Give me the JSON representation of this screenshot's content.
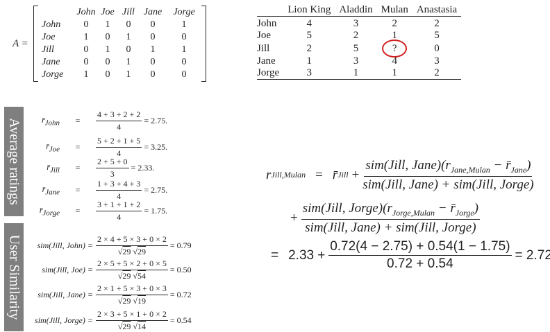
{
  "matrix": {
    "label": "A =",
    "col_headers": [
      "John",
      "Joe",
      "Jill",
      "Jane",
      "Jorge"
    ],
    "rows": [
      {
        "name": "John",
        "values": [
          "0",
          "1",
          "0",
          "0",
          "1"
        ]
      },
      {
        "name": "Joe",
        "values": [
          "1",
          "0",
          "1",
          "0",
          "0"
        ]
      },
      {
        "name": "Jill",
        "values": [
          "0",
          "1",
          "0",
          "1",
          "1"
        ]
      },
      {
        "name": "Jane",
        "values": [
          "0",
          "0",
          "1",
          "0",
          "0"
        ]
      },
      {
        "name": "Jorge",
        "values": [
          "1",
          "0",
          "1",
          "0",
          "0"
        ]
      }
    ]
  },
  "ratings": {
    "headers": [
      "Lion King",
      "Aladdin",
      "Mulan",
      "Anastasia"
    ],
    "rows": [
      {
        "name": "John",
        "values": [
          "4",
          "3",
          "2",
          "2"
        ]
      },
      {
        "name": "Joe",
        "values": [
          "5",
          "2",
          "1",
          "5"
        ]
      },
      {
        "name": "Jill",
        "values": [
          "2",
          "5",
          "?",
          "0"
        ]
      },
      {
        "name": "Jane",
        "values": [
          "1",
          "3",
          "4",
          "3"
        ]
      },
      {
        "name": "Jorge",
        "values": [
          "3",
          "1",
          "1",
          "2"
        ]
      }
    ],
    "highlight_color": "#d21f1f"
  },
  "sidebars": {
    "average": "Average ratings",
    "similarity": "User Similarity",
    "color": "#7f7f7f"
  },
  "averages": [
    {
      "sub": "John",
      "num": "4 + 3 + 2 + 2",
      "den": "4",
      "result": "= 2.75."
    },
    {
      "sub": "Joe",
      "num": "5 + 2 + 1 + 5",
      "den": "4",
      "result": "= 3.25."
    },
    {
      "sub": "Jill",
      "num": "2 + 5 + 0",
      "den": "3",
      "result": "= 2.33."
    },
    {
      "sub": "Jane",
      "num": "1 + 3 + 4 + 3",
      "den": "4",
      "result": "= 2.75."
    },
    {
      "sub": "Jorge",
      "num": "3 + 1 + 1 + 2",
      "den": "4",
      "result": "= 1.75."
    }
  ],
  "similarities": [
    {
      "lhs": "sim(Jill, John) =",
      "num": "2 × 4 + 5 × 3 + 0 × 2",
      "den_a": "29",
      "den_b": "29",
      "result": "= 0.79"
    },
    {
      "lhs": "sim(Jill, Joe) =",
      "num": "2 × 5 + 5 × 2 + 0 × 5",
      "den_a": "29",
      "den_b": "54",
      "result": "= 0.50"
    },
    {
      "lhs": "sim(Jill, Jane) =",
      "num": "2 × 1 + 5 × 3 + 0 × 3",
      "den_a": "29",
      "den_b": "19",
      "result": "= 0.72"
    },
    {
      "lhs": "sim(Jill, Jorge) =",
      "num": "2 × 3 + 5 × 1 + 0 × 2",
      "den_a": "29",
      "den_b": "14",
      "result": "= 0.54"
    }
  ],
  "prediction": {
    "lhs_r": "r",
    "lhs_sub": "Jill,Mulan",
    "equals": "=",
    "rbar_sub": "Jill",
    "plus": "+",
    "term1_num_sim": "sim(Jill, Jane)(r",
    "term1_num_sub": "Jane,Mulan",
    "term1_num_minus": " − r̄",
    "term1_num_sub2": "Jane",
    "term1_num_close": ")",
    "term2_num_sim": "sim(Jill, Jorge)(r",
    "term2_num_sub": "Jorge,Mulan",
    "term2_num_minus": " − r̄",
    "term2_num_sub2": "Jorge",
    "term2_num_close": ")",
    "den": "sim(Jill, Jane) + sim(Jill, Jorge)",
    "final_eq": "=",
    "final_a": "2.33",
    "final_plus": "+",
    "final_num": "0.72(4 − 2.75) + 0.54(1 − 1.75)",
    "final_den": "0.72 + 0.54",
    "final_result": "= 2.72"
  }
}
